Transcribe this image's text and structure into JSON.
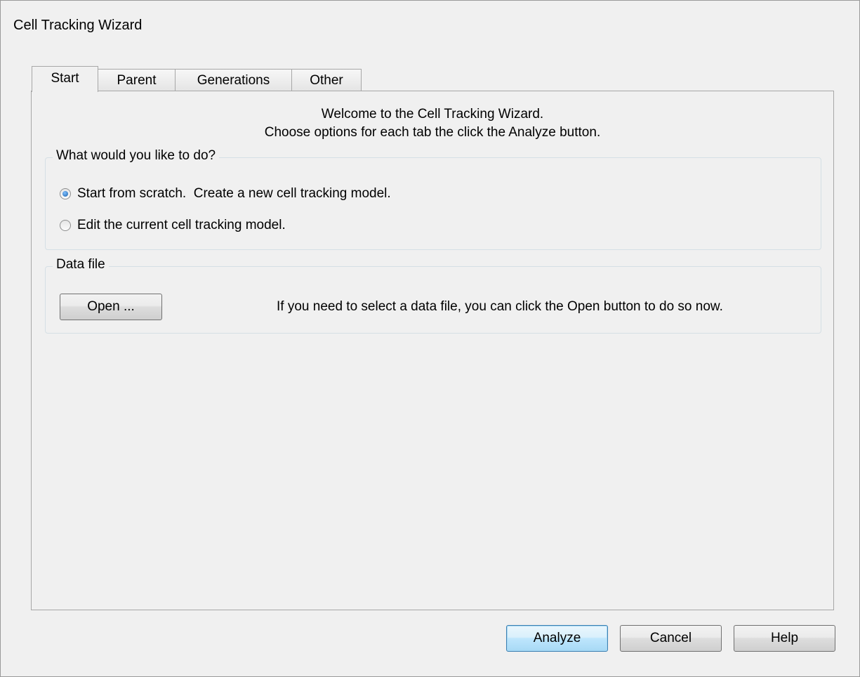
{
  "window": {
    "title": "Cell Tracking Wizard"
  },
  "tabs": [
    {
      "label": "Start",
      "active": true
    },
    {
      "label": "Parent",
      "active": false
    },
    {
      "label": "Generations",
      "active": false
    },
    {
      "label": "Other",
      "active": false
    }
  ],
  "welcome": {
    "line1": "Welcome to the Cell Tracking Wizard.",
    "line2": "Choose options for each tab the click the Analyze button."
  },
  "task_group": {
    "legend": "What would you like to do?",
    "options": [
      {
        "label": "Start from scratch.  Create a new cell tracking model.",
        "selected": true
      },
      {
        "label": "Edit the current cell tracking model.",
        "selected": false
      }
    ]
  },
  "data_file_group": {
    "legend": "Data file",
    "open_button": "Open ...",
    "hint": "If you need to select a data file, you can click the Open button to do so now."
  },
  "footer": {
    "analyze": "Analyze",
    "cancel": "Cancel",
    "help": "Help"
  }
}
